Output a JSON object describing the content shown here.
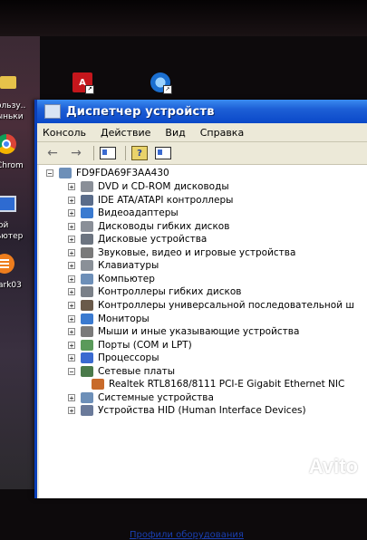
{
  "desktop": {
    "icon_labels": [
      "ользу..",
      "ыньки",
      "Chrom",
      "ой",
      "ьютер",
      "ark03"
    ]
  },
  "window": {
    "title": "Диспетчер устройств",
    "menu": [
      "Консоль",
      "Действие",
      "Вид",
      "Справка"
    ],
    "toolbar": [
      "back-arrow-icon",
      "forward-arrow-icon",
      "properties-icon",
      "help-icon",
      "scan-hardware-icon"
    ],
    "root": "FD9FDA69F3AA430",
    "items": [
      {
        "label": "DVD и CD-ROM дисководы",
        "expander": "+"
      },
      {
        "label": "IDE ATA/ATAPI контроллеры",
        "expander": "+"
      },
      {
        "label": "Видеоадаптеры",
        "expander": "+"
      },
      {
        "label": "Дисководы гибких дисков",
        "expander": "+"
      },
      {
        "label": "Дисковые устройства",
        "expander": "+"
      },
      {
        "label": "Звуковые, видео и игровые устройства",
        "expander": "+"
      },
      {
        "label": "Клавиатуры",
        "expander": "+"
      },
      {
        "label": "Компьютер",
        "expander": "+"
      },
      {
        "label": "Контроллеры гибких дисков",
        "expander": "+"
      },
      {
        "label": "Контроллеры универсальной последовательной ш",
        "expander": "+"
      },
      {
        "label": "Мониторы",
        "expander": "+"
      },
      {
        "label": "Мыши и иные указывающие устройства",
        "expander": "+"
      },
      {
        "label": "Порты (COM и LPT)",
        "expander": "+"
      },
      {
        "label": "Процессоры",
        "expander": "+"
      },
      {
        "label": "Сетевые платы",
        "expander": "−"
      },
      {
        "label": "Realtek RTL8168/8111 PCI-E Gigabit Ethernet NIC",
        "expander": ""
      },
      {
        "label": "Системные устройства",
        "expander": "+"
      },
      {
        "label": "Устройства HID (Human Interface Devices)",
        "expander": "+"
      }
    ],
    "bottom_link": "Профили оборудования"
  },
  "watermark": "Avito"
}
